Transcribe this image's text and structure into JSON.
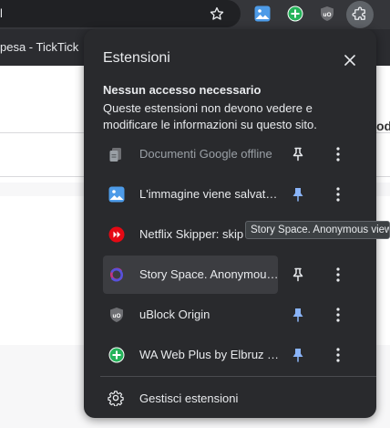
{
  "browser": {
    "omnibox_text": "l",
    "tab_title": "pesa - TickTick"
  },
  "page": {
    "peek_text": "od"
  },
  "popup": {
    "title": "Estensioni",
    "close_label": "×",
    "section_heading": "Nessun accesso necessario",
    "section_description": "Queste estensioni non devono vedere e modificare le informazioni su questo sito.",
    "extensions": [
      {
        "name": "Documenti Google offline",
        "icon": "google-docs-offline-icon",
        "pinned": false,
        "dimmed": true
      },
      {
        "name": "L'immagine viene salvata come...",
        "icon": "image-saver-icon",
        "pinned": true,
        "dimmed": false
      },
      {
        "name": "Netflix Skipper: skip intro",
        "icon": "netflix-skipper-icon",
        "pinned": false,
        "dimmed": false
      },
      {
        "name": "Story Space. Anonymous viewer",
        "icon": "story-space-icon",
        "pinned": false,
        "dimmed": false
      },
      {
        "name": "uBlock Origin",
        "icon": "ublock-origin-icon",
        "pinned": true,
        "dimmed": false
      },
      {
        "name": "WA Web Plus by Elbruz Technologies",
        "icon": "wa-web-plus-icon",
        "pinned": true,
        "dimmed": false
      }
    ],
    "manage_label": "Gestisci estensioni"
  },
  "tooltip": {
    "text": "Story Space. Anonymous viewer"
  },
  "colors": {
    "popup_bg": "#292a2d",
    "pin_active": "#8ab4f8",
    "pin_inactive": "#e8eaed",
    "hover_row": "#3c3d41"
  }
}
